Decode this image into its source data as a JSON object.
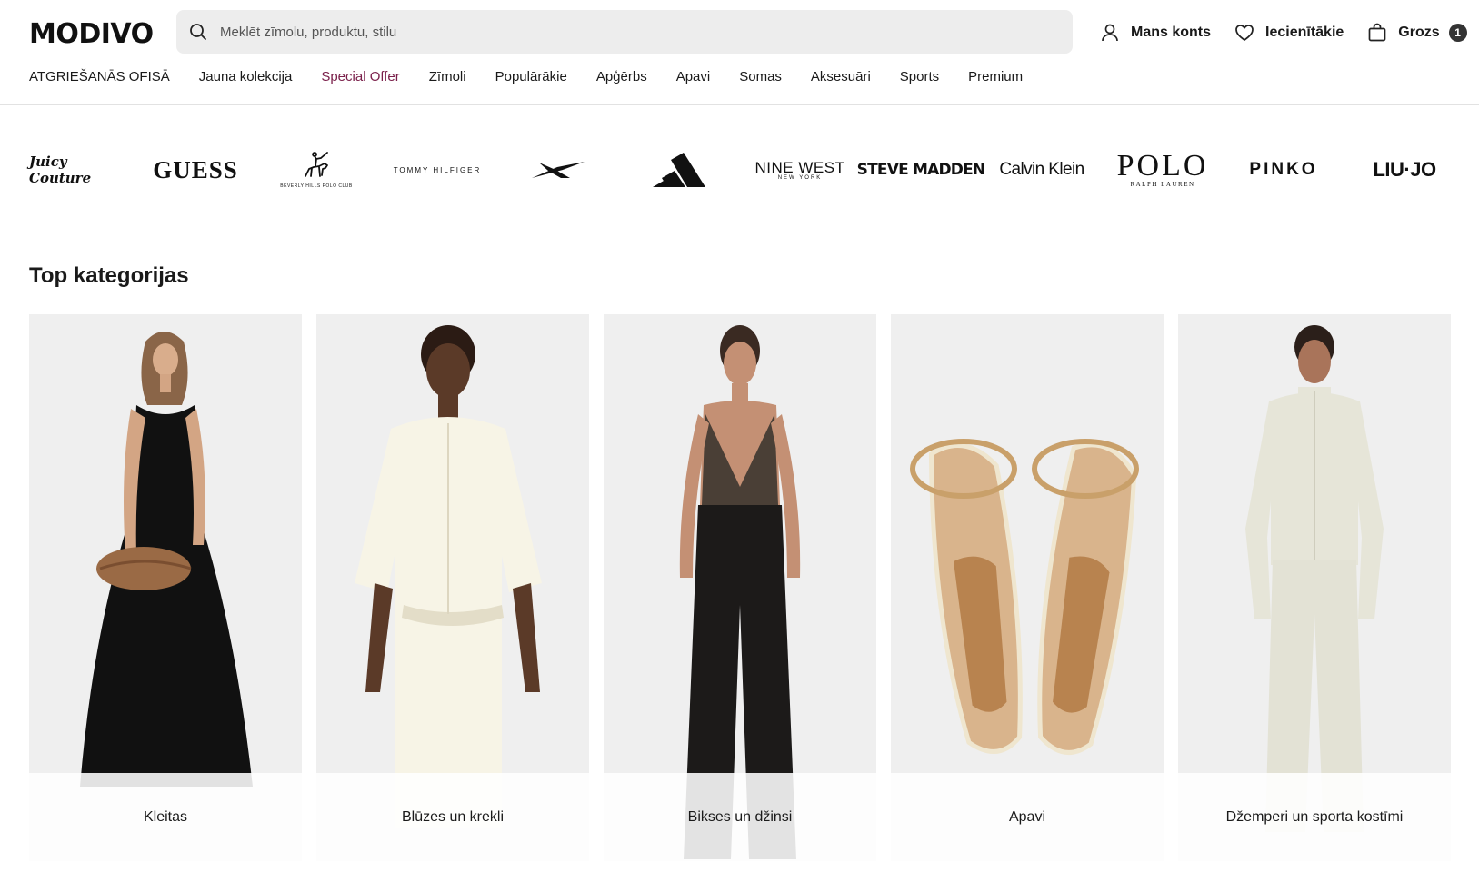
{
  "header": {
    "logo": "MODIVO",
    "search": {
      "placeholder": "Meklēt zīmolu, produktu, stilu"
    },
    "actions": [
      {
        "label": "Mans konts",
        "icon": "user-icon"
      },
      {
        "label": "Iecienītākie",
        "icon": "heart-icon"
      },
      {
        "label": "Grozs",
        "icon": "bag-icon",
        "badge": "1"
      }
    ]
  },
  "nav": [
    "ATGRIEŠANĀS OFISĀ",
    "Jauna kolekcija",
    "Special Offer",
    "Zīmoli",
    "Populārākie",
    "Apģērbs",
    "Apavi",
    "Somas",
    "Aksesuāri",
    "Sports",
    "Premium"
  ],
  "brands": {
    "juicy": "Juicy Couture",
    "guess": "GUESS",
    "beverly_sub": "BEVERLY HILLS POLO CLUB",
    "tommy": "TOMMY  HILFIGER",
    "nine_west": "NINE WEST",
    "nine_west_sub": "NEW YORK",
    "steve_madden": "STEVE MADDEN",
    "calvin_klein": "Calvin Klein",
    "polo": "POLO",
    "polo_sub": "RALPH LAUREN",
    "pinko": "PINKO",
    "liujo": "LIU·JO"
  },
  "section": {
    "title": "Top kategorijas",
    "categories": [
      "Kleitas",
      "Blūzes un krekli",
      "Bikses un džinsi",
      "Apavi",
      "Džemperi un sporta kostīmi"
    ]
  },
  "colors": {
    "accent_special": "#7a1f4a",
    "search_bg": "#ededed",
    "card_bg": "#efefef"
  }
}
